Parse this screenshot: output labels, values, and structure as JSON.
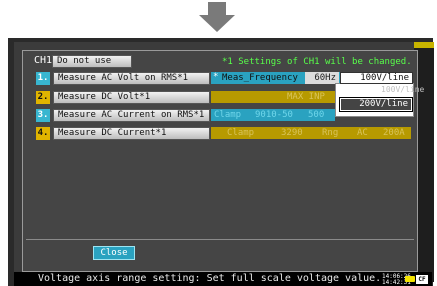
{
  "header": {
    "channel": "CH1",
    "not_use_label": "Do not use",
    "note": "*1 Settings of CH1 will be changed."
  },
  "measurements": [
    {
      "number": "1.",
      "label": "Measure AC Volt on RMS*1"
    },
    {
      "number": "2.",
      "label": "Measure DC Volt*1"
    },
    {
      "number": "3.",
      "label": "Measure AC Current on RMS*1"
    },
    {
      "number": "4.",
      "label": "Measure DC Current*1"
    }
  ],
  "row1": {
    "marker": "*",
    "field_label": "Meas_Frequency",
    "frequency_value": "60Hz",
    "range_value": "100V/line"
  },
  "row2": {
    "max_input": "MAX INP"
  },
  "row3": {
    "clamp": "Clamp",
    "clamp_value": "9010-50",
    "more": "500"
  },
  "row4": {
    "clamp": "Clamp",
    "clamp_value": "3290",
    "range_label": "Rng",
    "range_mode": "AC",
    "range_value": "200A"
  },
  "dropdown": {
    "options": [
      "100V/line",
      "200V/line"
    ],
    "selected": "200V/line"
  },
  "close_label": "Close",
  "status": {
    "message": "Voltage axis range setting: Set full scale voltage value.",
    "clock": "14:06:26 14:42:31",
    "card": "CF"
  },
  "colors": {
    "cyan": "#2aa2c0",
    "amber": "#e0b400",
    "note_green": "#58ff4a"
  }
}
